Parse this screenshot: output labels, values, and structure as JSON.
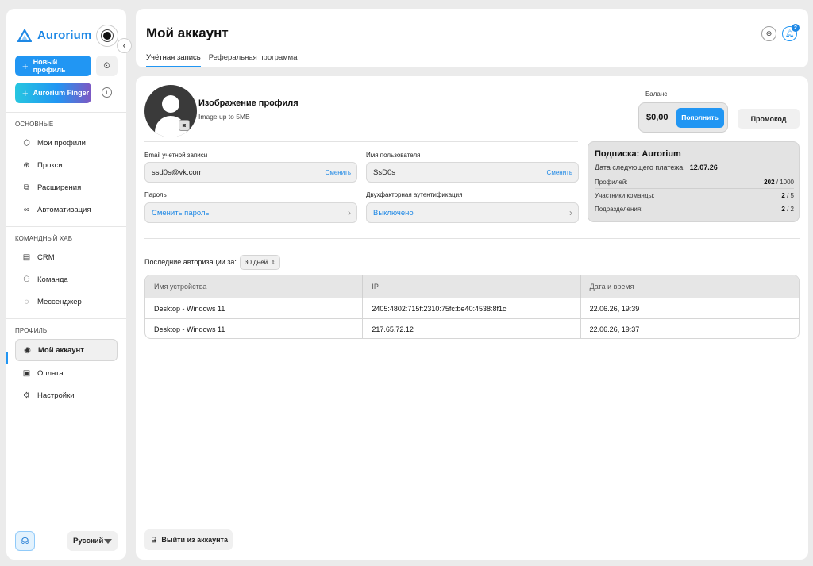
{
  "brand": {
    "name": "Aurorium",
    "accent": "#1e88e5"
  },
  "sidebar": {
    "new_profile_label": "Новый профиль",
    "finger_label": "Aurorium Finger",
    "sections": [
      {
        "title": "ОСНОВНЫЕ",
        "items": [
          {
            "label": "Мои профили",
            "icon": "profiles-icon"
          },
          {
            "label": "Прокси",
            "icon": "globe-icon"
          },
          {
            "label": "Расширения",
            "icon": "puzzle-icon"
          },
          {
            "label": "Автоматизация",
            "icon": "automation-icon"
          }
        ]
      },
      {
        "title": "КОМАНДНЫЙ ХАБ",
        "items": [
          {
            "label": "CRM",
            "icon": "crm-icon"
          },
          {
            "label": "Команда",
            "icon": "team-icon"
          },
          {
            "label": "Мессенджер",
            "icon": "chat-icon"
          }
        ]
      },
      {
        "title": "ПРОФИЛЬ",
        "items": [
          {
            "label": "Мой аккаунт",
            "icon": "user-circle-icon",
            "active": true
          },
          {
            "label": "Оплата",
            "icon": "wallet-icon"
          },
          {
            "label": "Настройки",
            "icon": "gear-icon"
          }
        ]
      }
    ],
    "language": "Русский"
  },
  "header": {
    "title": "Мой аккаунт",
    "tabs": [
      {
        "label": "Учётная запись",
        "active": true
      },
      {
        "label": "Реферальная программа",
        "active": false
      }
    ],
    "notification_count": "2"
  },
  "profile": {
    "image_title": "Изображение профиля",
    "image_hint": "Image up to 5MB"
  },
  "balance": {
    "label": "Баланс",
    "value": "$0,00",
    "topup_label": "Пополнить",
    "promo_label": "Промокод"
  },
  "fields": {
    "email_label": "Email учетной записи",
    "email_value": "ssd0s@vk.com",
    "email_action": "Сменить",
    "username_label": "Имя пользователя",
    "username_value": "SsD0s",
    "username_action": "Сменить",
    "password_label": "Пароль",
    "password_action": "Сменить пароль",
    "twofa_label": "Двухфакторная аутентификация",
    "twofa_value": "Выключено"
  },
  "subscription": {
    "title": "Подписка: Aurorium",
    "next_payment_label": "Дата следующего платежа:",
    "next_payment_date": "12.07.26",
    "rows": [
      {
        "label": "Профилей:",
        "used": "202",
        "total": " / 1000"
      },
      {
        "label": "Участники команды:",
        "used": "2",
        "total": " / 5"
      },
      {
        "label": "Подразделения:",
        "used": "2",
        "total": " / 2"
      }
    ]
  },
  "auth_history": {
    "label": "Последние авторизации за:",
    "period": "30 дней",
    "columns": [
      "Имя устройства",
      "IP",
      "Дата и время"
    ],
    "rows": [
      [
        "Desktop - Windows 11",
        "2405:4802:715f:2310:75fc:be40:4538:8f1c",
        "22.06.26, 19:39"
      ],
      [
        "Desktop - Windows 11",
        "217.65.72.12",
        "22.06.26, 19:37"
      ]
    ]
  },
  "logout_label": "Выйти из аккаунта"
}
